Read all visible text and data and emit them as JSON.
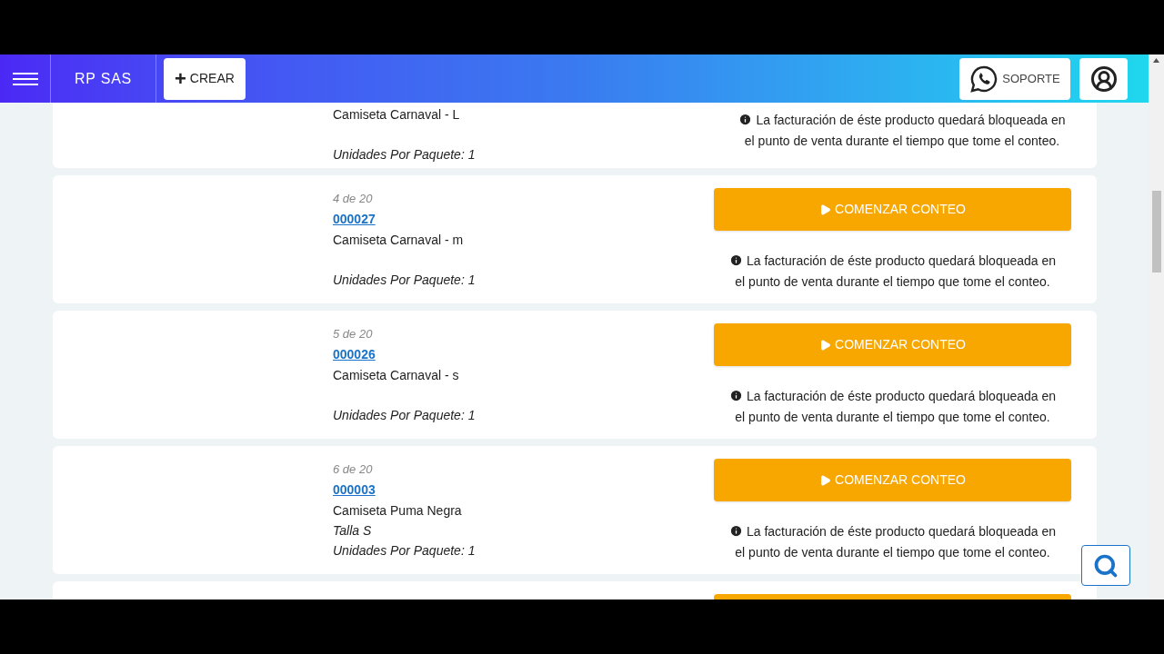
{
  "header": {
    "brand": "RP SAS",
    "create_label": "CREAR",
    "create_icon": "+",
    "support_label": "SOPORTE"
  },
  "items": [
    {
      "kind": "cut_top",
      "name": "Camiseta Carnaval - L",
      "units": "Unidades Por Paquete: 1",
      "info": "La facturación de éste producto quedará bloqueada en el punto de venta durante el tiempo que tome el conteo."
    },
    {
      "kind": "full",
      "counter": "4 de 20",
      "code": "000027",
      "name": "Camiseta Carnaval - m",
      "units": "Unidades Por Paquete: 1",
      "button": "COMENZAR CONTEO",
      "info": "La facturación de éste producto quedará bloqueada en el punto de venta durante el tiempo que tome el conteo."
    },
    {
      "kind": "full",
      "counter": "5 de 20",
      "code": "000026",
      "name": "Camiseta Carnaval - s",
      "units": "Unidades Por Paquete: 1",
      "button": "COMENZAR CONTEO",
      "info": "La facturación de éste producto quedará bloqueada en el punto de venta durante el tiempo que tome el conteo."
    },
    {
      "kind": "full",
      "counter": "6 de 20",
      "code": "000003",
      "name": "Camiseta Puma Negra",
      "variant": "Talla S",
      "units": "Unidades Por Paquete: 1",
      "button": "COMENZAR CONTEO",
      "info": "La facturación de éste producto quedará bloqueada en el punto de venta durante el tiempo que tome el conteo."
    },
    {
      "kind": "cut_bottom"
    }
  ]
}
